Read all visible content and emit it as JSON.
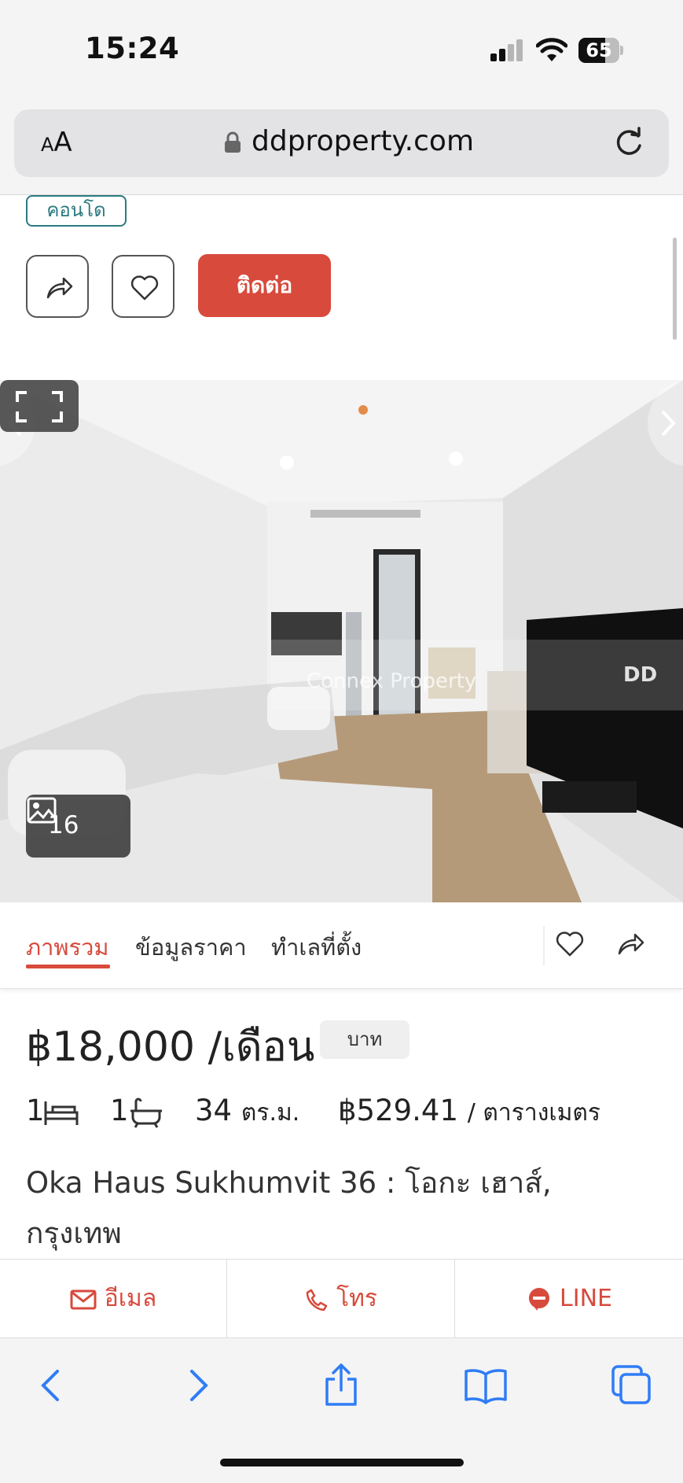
{
  "status_bar": {
    "time": "15:24",
    "battery": "65",
    "battery_level": 0.65
  },
  "browser": {
    "text_size_small": "A",
    "text_size_large": "A",
    "url": "ddproperty.com"
  },
  "listing": {
    "property_type_tag": "คอนโด",
    "contact_label": "ติดต่อ",
    "photo_count": "16",
    "watermark": "Connex Property",
    "brand_mark": "DD",
    "tabs": [
      {
        "label": "ภาพรวม",
        "active": true
      },
      {
        "label": "ข้อมูลราคา",
        "active": false
      },
      {
        "label": "ทำเลที่ตั้ง",
        "active": false
      }
    ],
    "price": "฿18,000 /เดือน",
    "price_unit_chip": "บาท",
    "bedrooms": "1",
    "bathrooms": "1",
    "area": "34",
    "area_unit": "ตร.ม.",
    "price_per_area": "฿529.41",
    "price_per_area_unit": "/ ตารางเมตร",
    "title": "Oka Haus Sukhumvit 36 : โอกะ เฮาส์, กรุงเทพ"
  },
  "actions": {
    "email_label": "อีเมล",
    "phone_label": "โทร",
    "line_label": "LINE"
  },
  "colors": {
    "accent": "#d74a3c",
    "tag": "#2a7a80",
    "safari_blue": "#2f7cf6"
  }
}
